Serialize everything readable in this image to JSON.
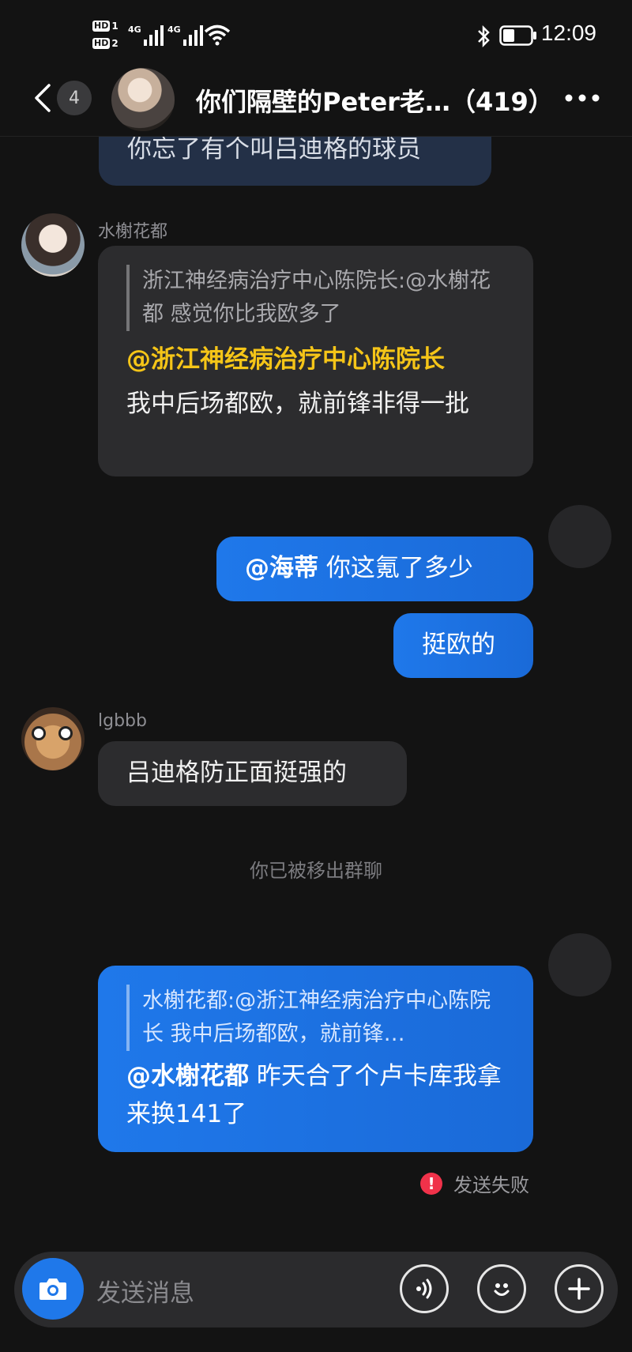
{
  "status_bar": {
    "sim1_label": "HD",
    "sim1_num": "1",
    "sim2_label": "HD",
    "sim2_num": "2",
    "net1": "4G",
    "net2": "4G",
    "time": "12:09"
  },
  "header": {
    "unread_count": "4",
    "title": "你们隔壁的Peter老…（419）"
  },
  "messages": {
    "partial_top": {
      "text": "你忘了有个叫吕迪格的球员"
    },
    "msg1": {
      "sender": "水榭花都",
      "quote": "浙江神经病治疗中心陈院长:@水榭花都 感觉你比我欧多了",
      "mention": "@浙江神经病治疗中心陈院长",
      "text": "我中后场都欧，就前锋非得一批"
    },
    "msg2": {
      "mention": "@海蒂",
      "text": " 你这氪了多少"
    },
    "msg3": {
      "text": "挺欧的"
    },
    "msg4": {
      "sender": "lgbbb",
      "text": "吕迪格防正面挺强的"
    },
    "system_notice": "你已被移出群聊",
    "msg5": {
      "quote": "水榭花都:@浙江神经病治疗中心陈院长 我中后场都欧，就前锋…",
      "mention": "@水榭花都",
      "text": " 昨天合了个卢卡库我拿来换141了",
      "status_text": "发送失败",
      "status_icon": "!"
    }
  },
  "input_bar": {
    "placeholder": "发送消息"
  },
  "colors": {
    "background": "#131313",
    "bubble_gray": "#2c2c2e",
    "bubble_blue": "#1f78ea",
    "mention_yellow": "#f5c518",
    "error_red": "#f0324a"
  },
  "icons": [
    "back-arrow-icon",
    "more-icon",
    "camera-icon",
    "voice-icon",
    "emoji-icon",
    "plus-icon",
    "error-icon",
    "bluetooth-icon",
    "battery-icon",
    "wifi-icon",
    "signal-icon"
  ]
}
